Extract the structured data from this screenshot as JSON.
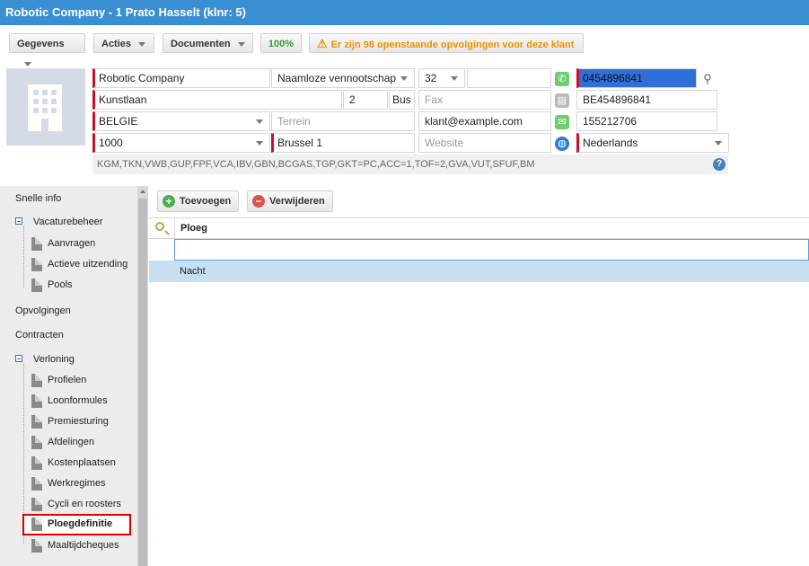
{
  "window": {
    "title": "Robotic Company - 1 Prato Hasselt (klnr: 5)"
  },
  "toolbar": {
    "gegevens": "Gegevens",
    "acties": "Acties",
    "documenten": "Documenten",
    "percent": "100%",
    "warning": "Er zijn 98 openstaande opvolgingen voor deze klant"
  },
  "form": {
    "name": "Robotic Company",
    "legal_form": "Naamloze vennootschap",
    "code": "32",
    "phone": "0454896841",
    "street": "Kunstlaan",
    "number": "2",
    "bus": "Bus",
    "fax_placeholder": "Fax",
    "vat": "BE454896841",
    "country": "BELGIE",
    "terrain_placeholder": "Terrein",
    "email": "klant@example.com",
    "extra_number": "155212706",
    "postcode": "1000",
    "city": "Brussel 1",
    "website_placeholder": "Website",
    "language": "Nederlands",
    "codes": "KGM,TKN,VWB,GUP,FPF,VCA,IBV,GBN,BCGAS,TGP,GKT=PC,ACC=1,TOF=2,GVA,VUT,SFUF,BM"
  },
  "sidebar": {
    "snelle_info": "Snelle info",
    "vacaturebeheer": "Vacaturebeheer",
    "aanvragen": "Aanvragen",
    "actieve_uitzending": "Actieve uitzending",
    "pools": "Pools",
    "opvolgingen": "Opvolgingen",
    "contracten": "Contracten",
    "verloning": "Verloning",
    "profielen": "Profielen",
    "loonformules": "Loonformules",
    "premiesturing": "Premiesturing",
    "afdelingen": "Afdelingen",
    "kostenplaatsen": "Kostenplaatsen",
    "werkregimes": "Werkregimes",
    "cycli": "Cycli en roosters",
    "ploegdefinitie": "Ploegdefinitie",
    "maaltijdcheques": "Maaltijdcheques"
  },
  "actions": {
    "add": "Toevoegen",
    "delete": "Verwijderen"
  },
  "grid": {
    "column": "Ploeg",
    "rows": [
      "Nacht"
    ]
  },
  "colors": {
    "titlebar": "#3a8fd3",
    "required": "#c8102e",
    "selected_row": "#c7dff3",
    "highlight": "#e00000"
  }
}
